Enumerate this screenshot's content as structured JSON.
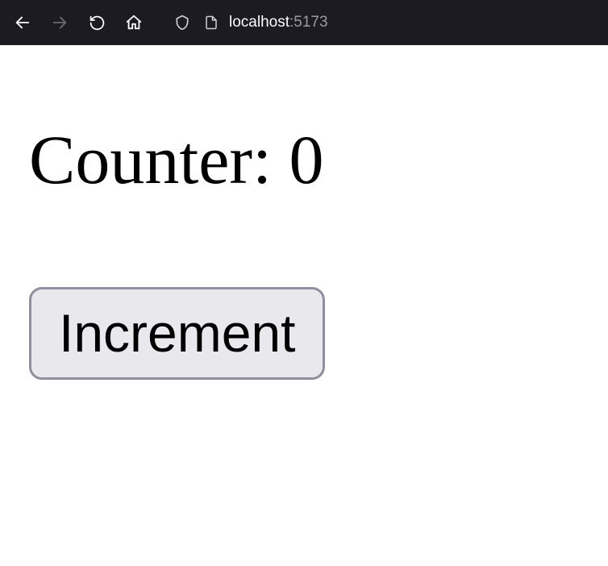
{
  "browser": {
    "url_host": "localhost",
    "url_port": ":5173"
  },
  "page": {
    "counter_label": "Counter: ",
    "counter_value": "0",
    "increment_label": "Increment"
  }
}
